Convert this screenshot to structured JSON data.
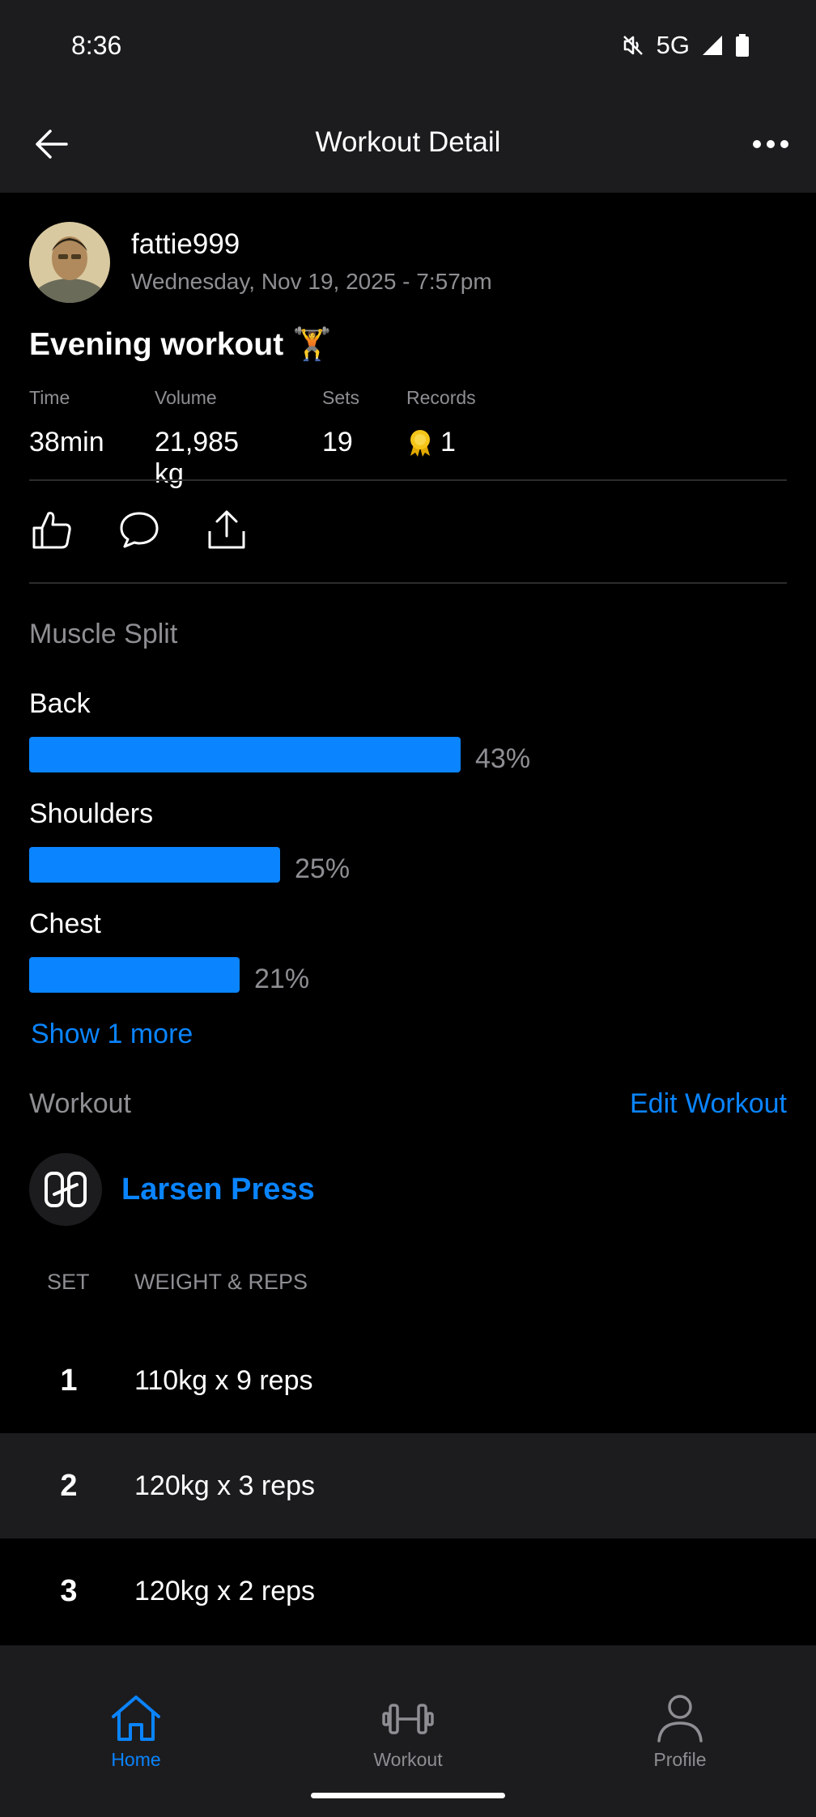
{
  "status_bar": {
    "time": "8:36",
    "network": "5G"
  },
  "app_bar": {
    "title": "Workout Detail"
  },
  "post": {
    "username": "fattie999",
    "date": "Wednesday, Nov 19, 2025 - 7:57pm",
    "title": "Evening workout 🏋️"
  },
  "stats": [
    {
      "label": "Time",
      "value": "38min"
    },
    {
      "label": "Volume",
      "value": "21,985 kg"
    },
    {
      "label": "Sets",
      "value": "19"
    },
    {
      "label": "Records",
      "value": "1"
    }
  ],
  "muscle_split": {
    "title": "Muscle Split",
    "items": [
      {
        "label": "Back",
        "percent_text": "43%",
        "fraction": 0.43
      },
      {
        "label": "Shoulders",
        "percent_text": "25%",
        "fraction": 0.25
      },
      {
        "label": "Chest",
        "percent_text": "21%",
        "fraction": 0.21
      }
    ],
    "show_more": "Show 1 more"
  },
  "workout": {
    "title": "Workout",
    "edit_label": "Edit Workout",
    "exercise_name": "Larsen Press",
    "columns": {
      "set": "SET",
      "weight_reps": "WEIGHT & REPS"
    },
    "sets": [
      {
        "number": "1",
        "value": "110kg x 9 reps"
      },
      {
        "number": "2",
        "value": "120kg x 3 reps"
      },
      {
        "number": "3",
        "value": "120kg x 2 reps"
      }
    ]
  },
  "bottom_nav": [
    {
      "label": "Home",
      "icon": "home-icon",
      "active": true
    },
    {
      "label": "Workout",
      "icon": "dumbbell-icon",
      "active": false
    },
    {
      "label": "Profile",
      "icon": "person-icon",
      "active": false
    }
  ],
  "colors": {
    "accent": "#0a84ff",
    "background": "#000000",
    "surface": "#1c1c1e",
    "muted": "#8e8e93"
  }
}
